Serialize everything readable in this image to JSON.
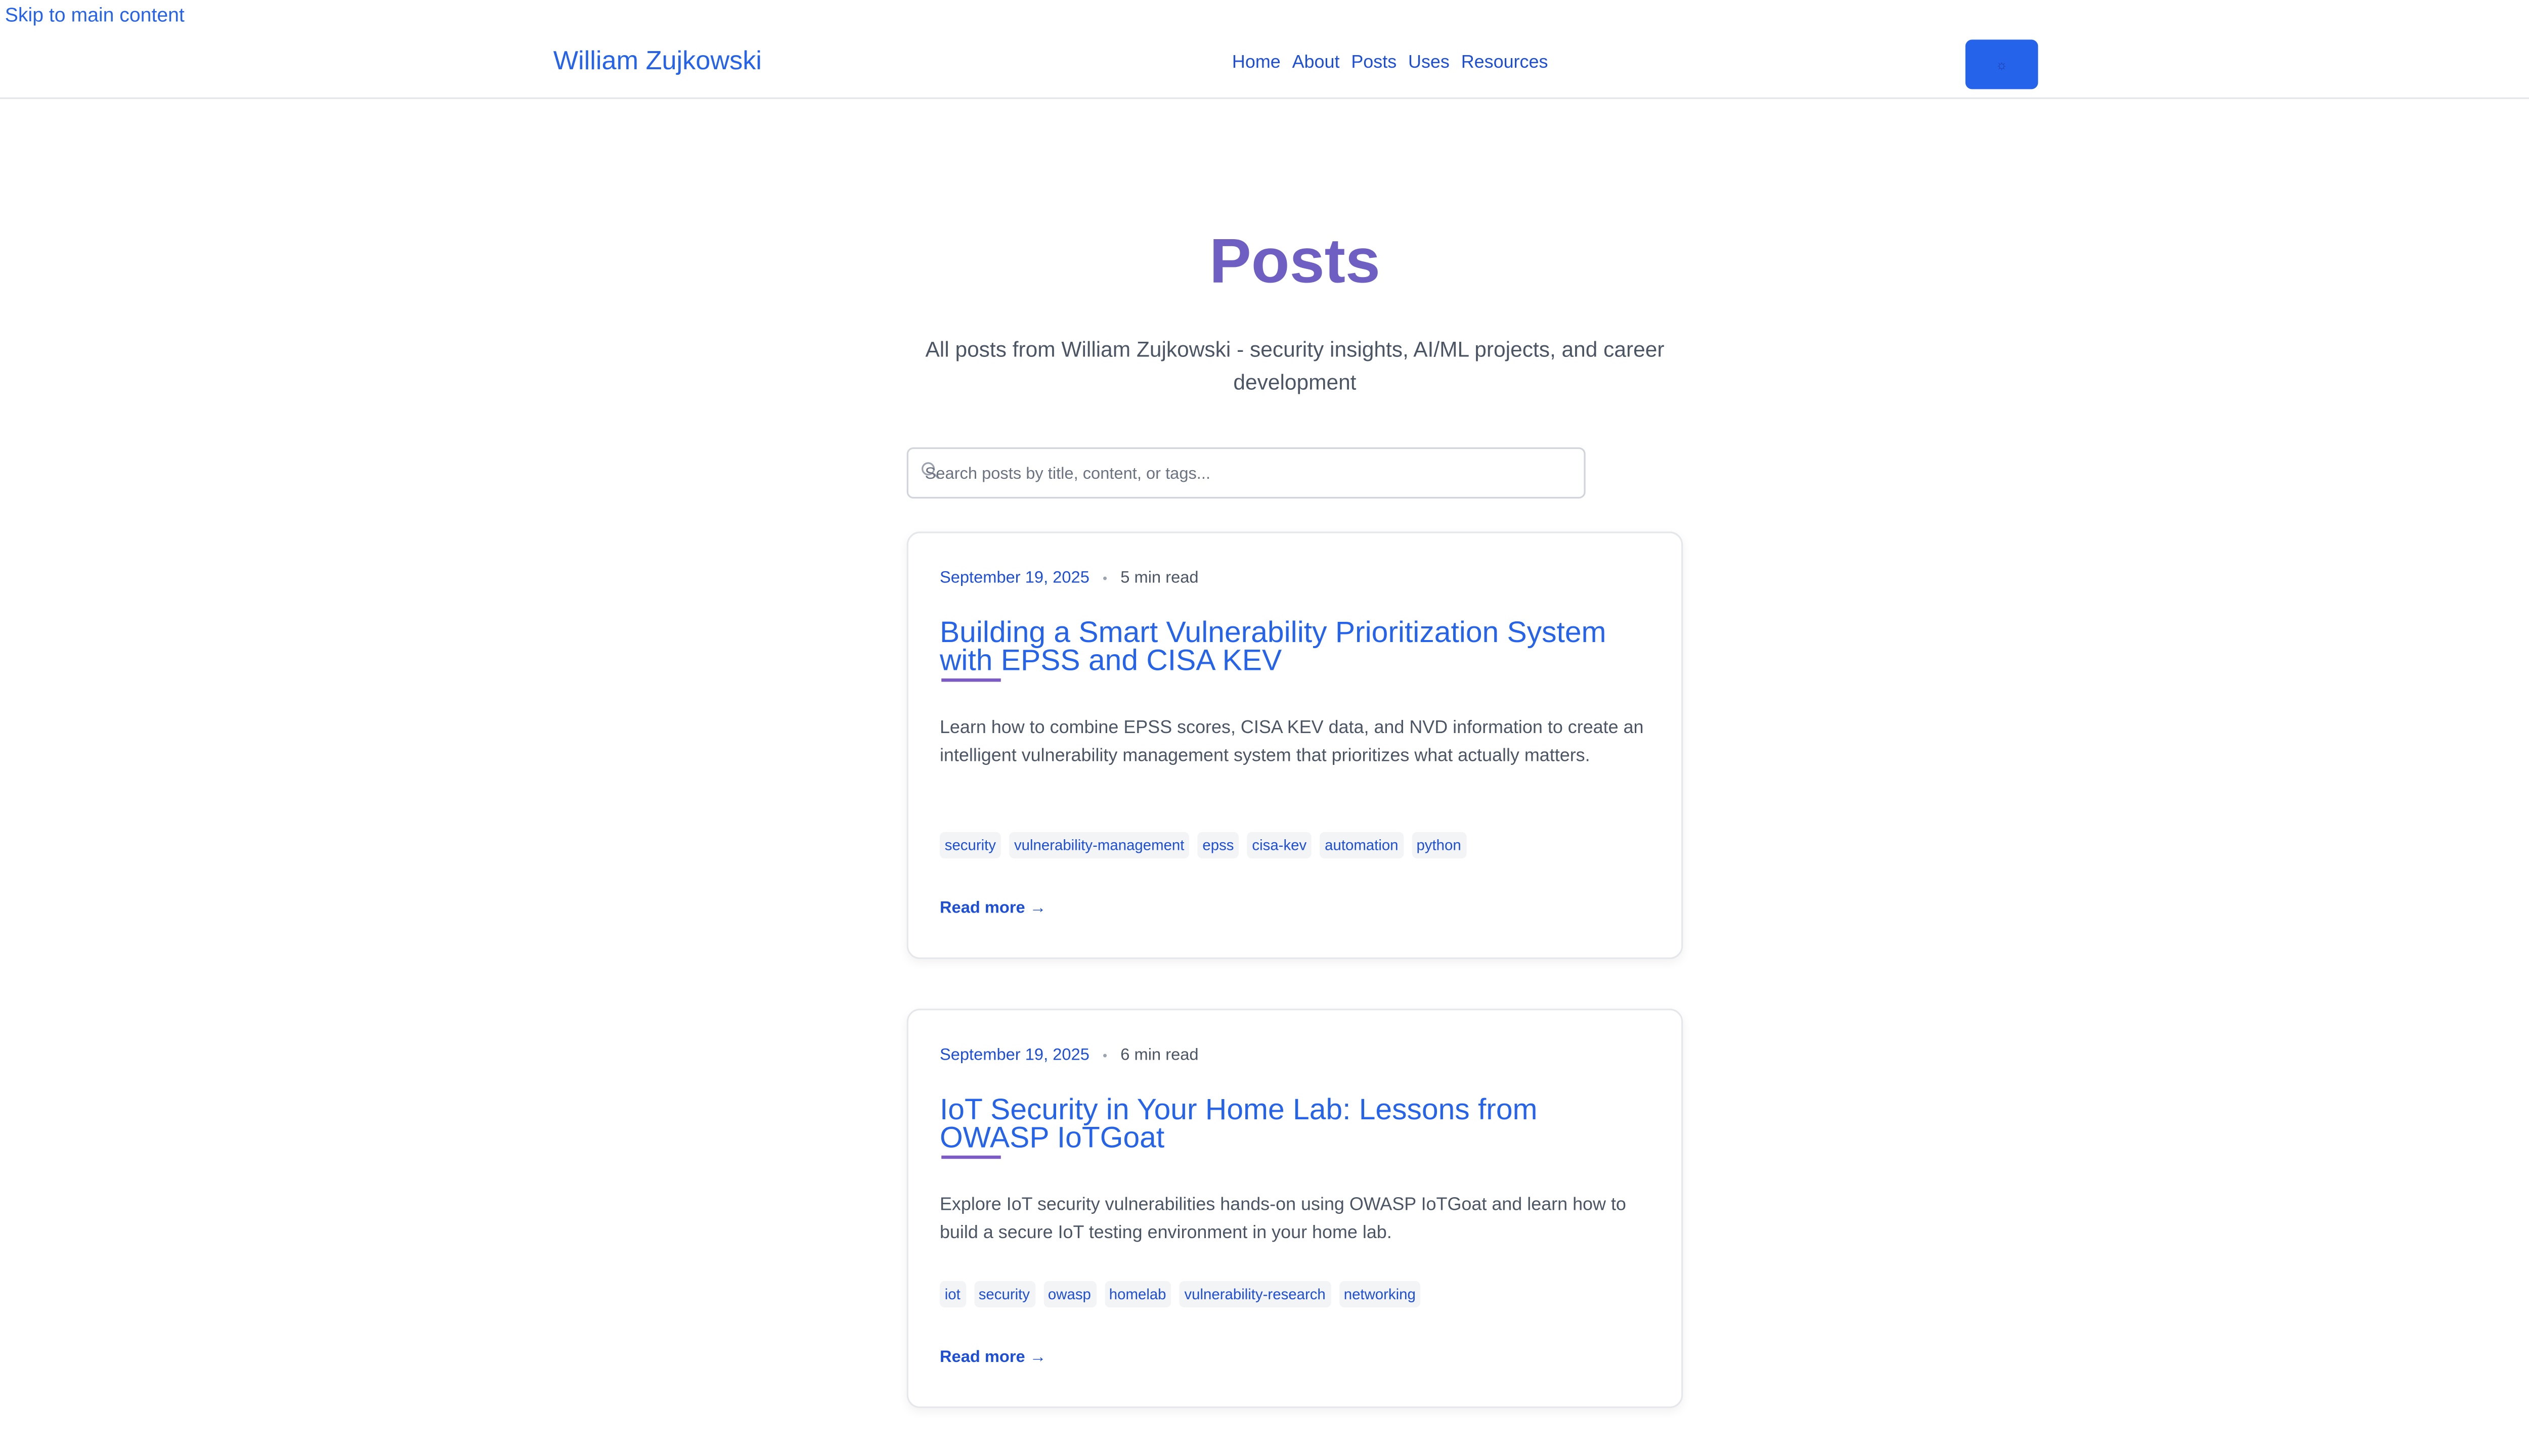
{
  "skip_link": "Skip to main content",
  "header": {
    "site_title": "William Zujkowski",
    "nav": [
      "Home",
      "About",
      "Posts",
      "Uses",
      "Resources"
    ],
    "theme_toggle_icon": "☼"
  },
  "page": {
    "title": "Posts",
    "subtitle": "All posts from William Zujkowski - security insights, AI/ML projects, and career development"
  },
  "search": {
    "placeholder": "Search posts by title, content, or tags...",
    "value": ""
  },
  "posts": [
    {
      "date": "September 19, 2025",
      "separator": "•",
      "read_time": "5 min read",
      "title": "Building a Smart Vulnerability Prioritization System with EPSS and CISA KEV",
      "excerpt": "Learn how to combine EPSS scores, CISA KEV data, and NVD information to create an intelligent vulnerability management system that prioritizes what actually matters.",
      "tags": [
        "security",
        "vulnerability-management",
        "epss",
        "cisa-kev",
        "automation",
        "python"
      ],
      "read_more": "Read more →"
    },
    {
      "date": "September 19, 2025",
      "separator": "•",
      "read_time": "6 min read",
      "title": "IoT Security in Your Home Lab: Lessons from OWASP IoTGoat",
      "excerpt": "Explore IoT security vulnerabilities hands-on using OWASP IoTGoat and learn how to build a secure IoT testing environment in your home lab.",
      "tags": [
        "iot",
        "security",
        "owasp",
        "homelab",
        "vulnerability-research",
        "networking"
      ],
      "read_more": "Read more →"
    }
  ],
  "colors": {
    "accent": "#2563eb",
    "title_purple": "#6f5fc3",
    "underline": "#7c5cc4"
  }
}
